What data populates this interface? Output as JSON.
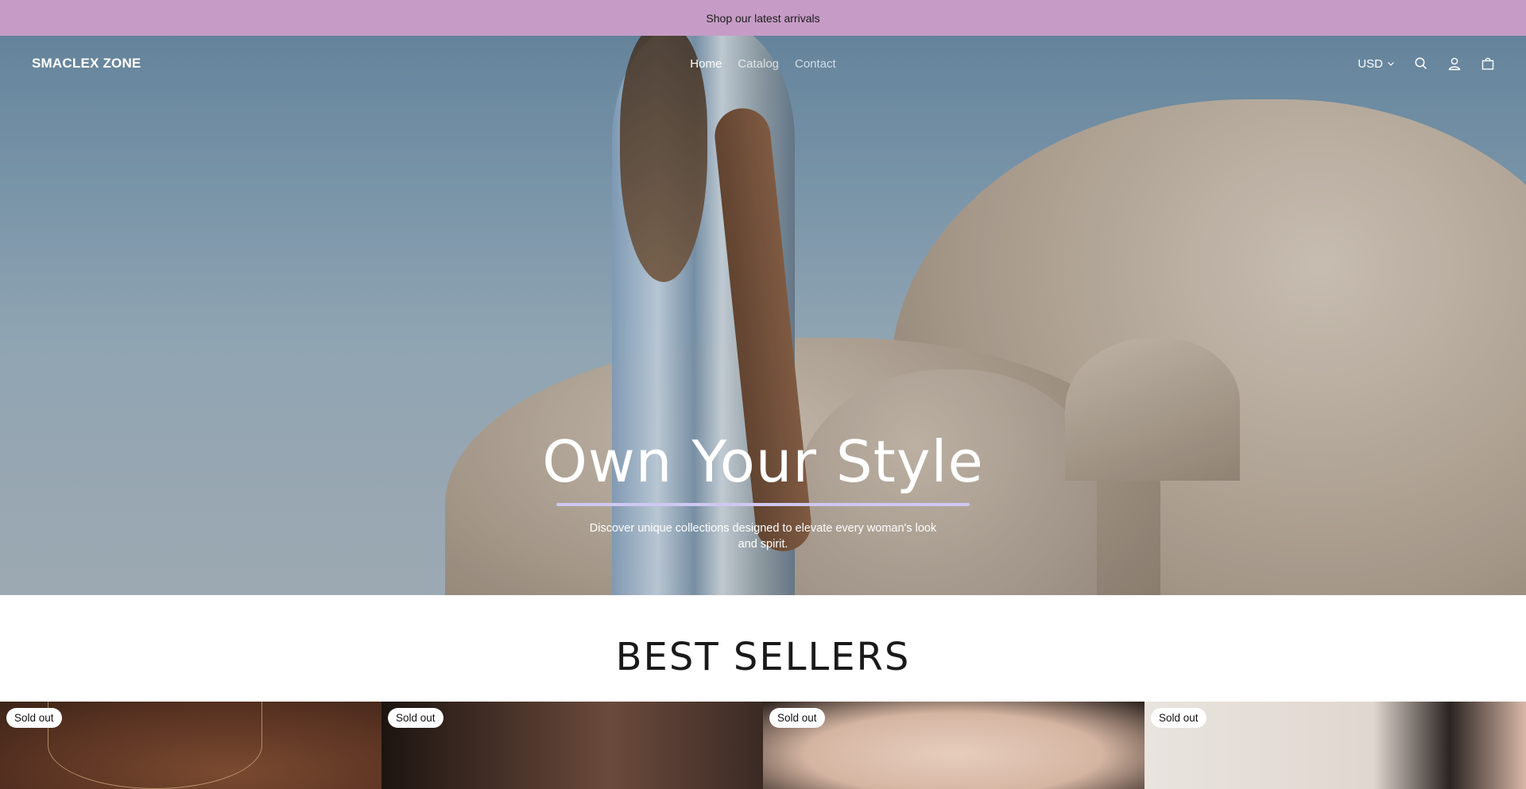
{
  "announcement": {
    "text": "Shop our latest arrivals"
  },
  "header": {
    "logo": "SMACLEX ZONE",
    "nav": [
      {
        "label": "Home"
      },
      {
        "label": "Catalog"
      },
      {
        "label": "Contact"
      }
    ],
    "currency": "USD"
  },
  "hero": {
    "title": "Own Your Style",
    "subtitle": "Discover unique collections designed to elevate every woman's look and spirit."
  },
  "best_sellers": {
    "title": "BEST SELLERS",
    "products": [
      {
        "badge": "Sold out"
      },
      {
        "badge": "Sold out"
      },
      {
        "badge": "Sold out"
      },
      {
        "badge": "Sold out"
      }
    ]
  },
  "colors": {
    "announcement_bg": "#c69cc6",
    "hero_underline": "#cfc8f3"
  }
}
